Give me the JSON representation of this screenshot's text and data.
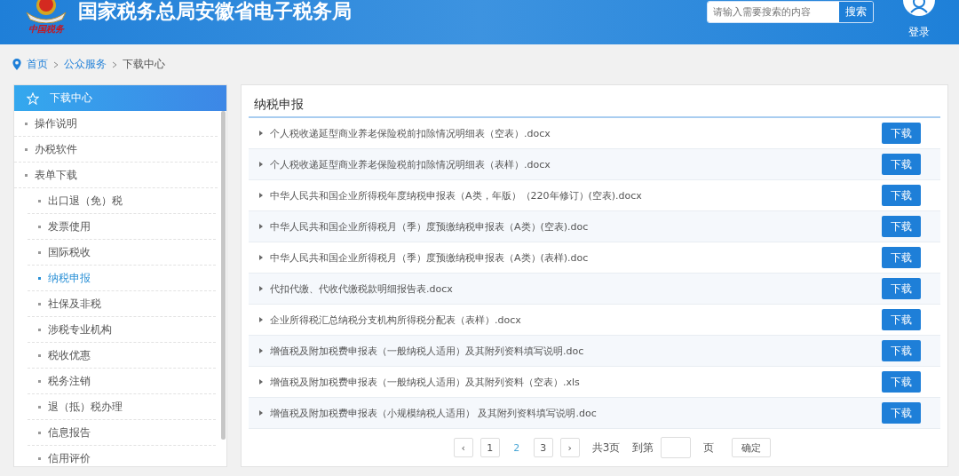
{
  "header": {
    "title": "国家税务总局安徽省电子税务局",
    "logo_caption": "中国税务",
    "search": {
      "placeholder": "请输入需要搜索的内容",
      "button": "搜索"
    },
    "login": "登录"
  },
  "breadcrumb": [
    "首页",
    "公众服务",
    "下载中心"
  ],
  "sidebar": {
    "title": "下载中心",
    "items": [
      {
        "label": "操作说明",
        "selected": false
      },
      {
        "label": "办税软件",
        "selected": false
      },
      {
        "label": "表单下载",
        "selected": false,
        "children": [
          {
            "label": "出口退（免）税",
            "selected": false
          },
          {
            "label": "发票使用",
            "selected": false
          },
          {
            "label": "国际税收",
            "selected": false
          },
          {
            "label": "纳税申报",
            "selected": true
          },
          {
            "label": "社保及非税",
            "selected": false
          },
          {
            "label": "涉税专业机构",
            "selected": false
          },
          {
            "label": "税收优惠",
            "selected": false
          },
          {
            "label": "税务注销",
            "selected": false
          },
          {
            "label": "退（抵）税办理",
            "selected": false
          },
          {
            "label": "信息报告",
            "selected": false
          },
          {
            "label": "信用评价",
            "selected": false
          }
        ]
      }
    ]
  },
  "content": {
    "title": "纳税申报",
    "files": [
      {
        "name": "个人税收递延型商业养老保险税前扣除情况明细表（空表）.docx",
        "button": "下载"
      },
      {
        "name": "个人税收递延型商业养老保险税前扣除情况明细表（表样）.docx",
        "button": "下载"
      },
      {
        "name": "中华人民共和国企业所得税年度纳税申报表（A类，年版）（220年修订）(空表).docx",
        "button": "下载"
      },
      {
        "name": "中华人民共和国企业所得税月（季）度预缴纳税申报表（A类）(空表).doc",
        "button": "下载"
      },
      {
        "name": "中华人民共和国企业所得税月（季）度预缴纳税申报表（A类）(表样).doc",
        "button": "下载"
      },
      {
        "name": "代扣代缴、代收代缴税款明细报告表.docx",
        "button": "下载"
      },
      {
        "name": "企业所得税汇总纳税分支机构所得税分配表（表样）.docx",
        "button": "下载"
      },
      {
        "name": "增值税及附加税费申报表（一般纳税人适用）及其附列资料填写说明.doc",
        "button": "下载"
      },
      {
        "name": "增值税及附加税费申报表（一般纳税人适用）及其附列资料（空表）.xls",
        "button": "下载"
      },
      {
        "name": "增值税及附加税费申报表（小规模纳税人适用） 及其附列资料填写说明.doc",
        "button": "下载"
      }
    ],
    "pagination": {
      "prev": "‹",
      "pages": [
        {
          "label": "1",
          "selected": false
        },
        {
          "label": "2",
          "selected": true
        },
        {
          "label": "3",
          "selected": false
        }
      ],
      "next": "›",
      "total": "共3页",
      "goto_prefix": "到第",
      "goto_suffix": "页",
      "confirm": "确定"
    }
  }
}
